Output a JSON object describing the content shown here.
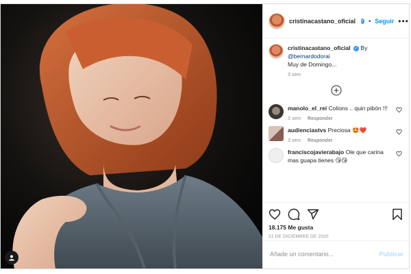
{
  "post": {
    "username": "cristinacastano_oficial",
    "verified_mark": "✓",
    "separator": "•",
    "follow_label": "Seguir",
    "more_label": "•••"
  },
  "caption": {
    "username": "cristinacastano_oficial",
    "text_line1": "By",
    "text_mention": "@bernardodorai",
    "text_line2": "Muy de Domingo...",
    "time": "3 sem"
  },
  "comments": [
    {
      "username": "manolo_el_rei",
      "text": "Colions .. quin pibón !!!",
      "time": "3 sem",
      "reply_label": "Responder"
    },
    {
      "username": "audienciastvs",
      "text": "Preciosa 🤩❤️",
      "time": "3 sem",
      "reply_label": "Responder"
    },
    {
      "username": "franciscojavierabajo",
      "text": "Ole que carina mas guapa tienes 😘😘",
      "time": "",
      "reply_label": ""
    }
  ],
  "actions": {
    "likes": "18.175 Me gusta",
    "date": "21 DE DICIEMBRE DE 2020"
  },
  "composer": {
    "placeholder": "Añade un comentario...",
    "publish_label": "Publicar"
  },
  "icons": [
    "heart-icon",
    "comment-icon",
    "share-icon",
    "bookmark-icon",
    "plus-circle-icon",
    "more-icon",
    "user-icon"
  ],
  "colors": {
    "link": "#0095f6",
    "verified": "#3897f0",
    "muted": "#8e8e8e",
    "publish_disabled": "#b2dffc"
  }
}
